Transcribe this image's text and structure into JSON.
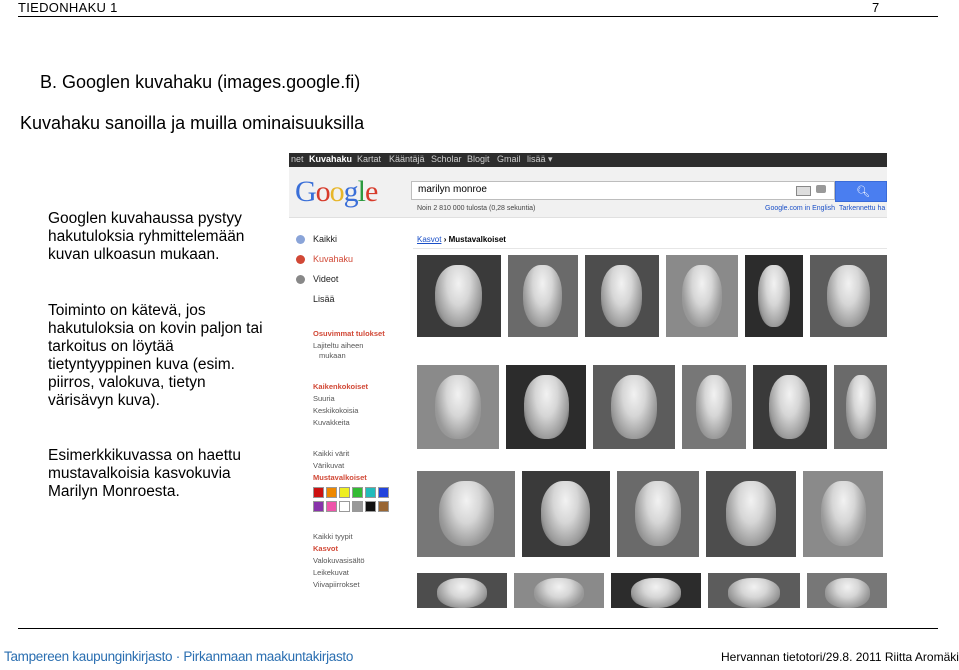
{
  "header": {
    "left": "TIEDONHAKU 1",
    "page": "7"
  },
  "title1": "B. Googlen kuvahaku (images.google.fi)",
  "title2": "Kuvahaku sanoilla ja muilla ominaisuuksilla",
  "paragraphs": [
    "Googlen kuvahaussa pystyy hakutuloksia ryhmittelemään kuvan ulkoasun mukaan.",
    "Toiminto on kätevä, jos hakutuloksia on kovin paljon tai tarkoitus on löytää tietyntyyppinen kuva (esim. piirros, valokuva, tietyn värisävyn kuva).",
    "Esimerkkikuvassa on haettu mustavalkoisia kasvokuvia Marilyn Monroesta."
  ],
  "screenshot": {
    "topbar": [
      "net",
      "Kuvahaku",
      "Kartat",
      "Kääntäjä",
      "Scholar",
      "Blogit",
      "Gmail",
      "lisää ▾"
    ],
    "logo": "Google",
    "search_value": "marilyn monroe",
    "results_count": "Noin 2 810 000 tulosta (0,28 sekuntia)",
    "link_right1": "Google.com in English",
    "link_right2": "Tarkennettu ha",
    "breadcrumb_link": "Kasvot",
    "breadcrumb_current": "› Mustavalkoiset",
    "side": {
      "kaikki": "Kaikki",
      "kuvahaku": "Kuvahaku",
      "videot": "Videot",
      "lisaa": "Lisää",
      "osuvimmat": "Osuvimmat tulokset",
      "lajiteltu1": "Lajiteltu aiheen",
      "lajiteltu2": "mukaan",
      "kaikenkokoiset": "Kaikenkokoiset",
      "suuria": "Suuria",
      "keskikokoisia": "Keskikokoisia",
      "kuvakkeita": "Kuvakkeita",
      "kaikki_varit": "Kaikki värit",
      "varikuvat": "Värikuvat",
      "mustavalkoiset": "Mustavalkoiset",
      "kaikki_tyypit": "Kaikki tyypit",
      "kasvot": "Kasvot",
      "valokuvasisalto": "Valokuvasisältö",
      "leikekuvat": "Leikekuvat",
      "viivapiirrokset": "Viivapiirrokset"
    },
    "swatch_colors": [
      "#cc1111",
      "#ee8800",
      "#eeee22",
      "#33bb33",
      "#22bbbb",
      "#2244dd",
      "#8833aa",
      "#ee55aa",
      "#ffffff",
      "#999999",
      "#111111",
      "#996633"
    ],
    "icons": [
      "search-icon",
      "camera-icon",
      "video-icon"
    ]
  },
  "footer": {
    "left": "Tampereen kaupunginkirjasto · Pirkanmaan maakuntakirjasto",
    "right": "Hervannan tietotori/29.8. 2011 Riitta Aromäki"
  }
}
